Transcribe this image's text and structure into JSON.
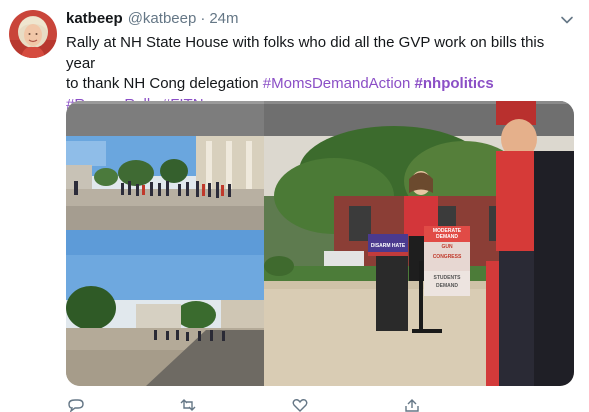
{
  "tweet": {
    "display_name": "katbeep",
    "handle": "@katbeep",
    "separator": "·",
    "timestamp": "24m",
    "text_line1": "Rally at NH State House with folks who did all the GVP work on bills this year",
    "text_line2_prefix": "to thank NH Cong delegation ",
    "hashtags": [
      "#MomsDemandAction",
      "#nhpolitics",
      "#RecessRally",
      "#FITN"
    ]
  },
  "media": {
    "sign_left": "DISARM HATE",
    "sign_right_lines": [
      "MODERATE",
      "DEMAND",
      "ACTION",
      "GUN",
      "SENSE",
      "CONGRESS",
      "STUDENTS",
      "DEMAND",
      "ACTION"
    ]
  },
  "actions": [
    {
      "icon": "reply-icon"
    },
    {
      "icon": "retweet-icon"
    },
    {
      "icon": "like-icon"
    },
    {
      "icon": "share-icon"
    }
  ],
  "colors": {
    "hashtag": "#8b4fc6",
    "secondary_text": "#657786",
    "primary_text": "#14171a"
  }
}
